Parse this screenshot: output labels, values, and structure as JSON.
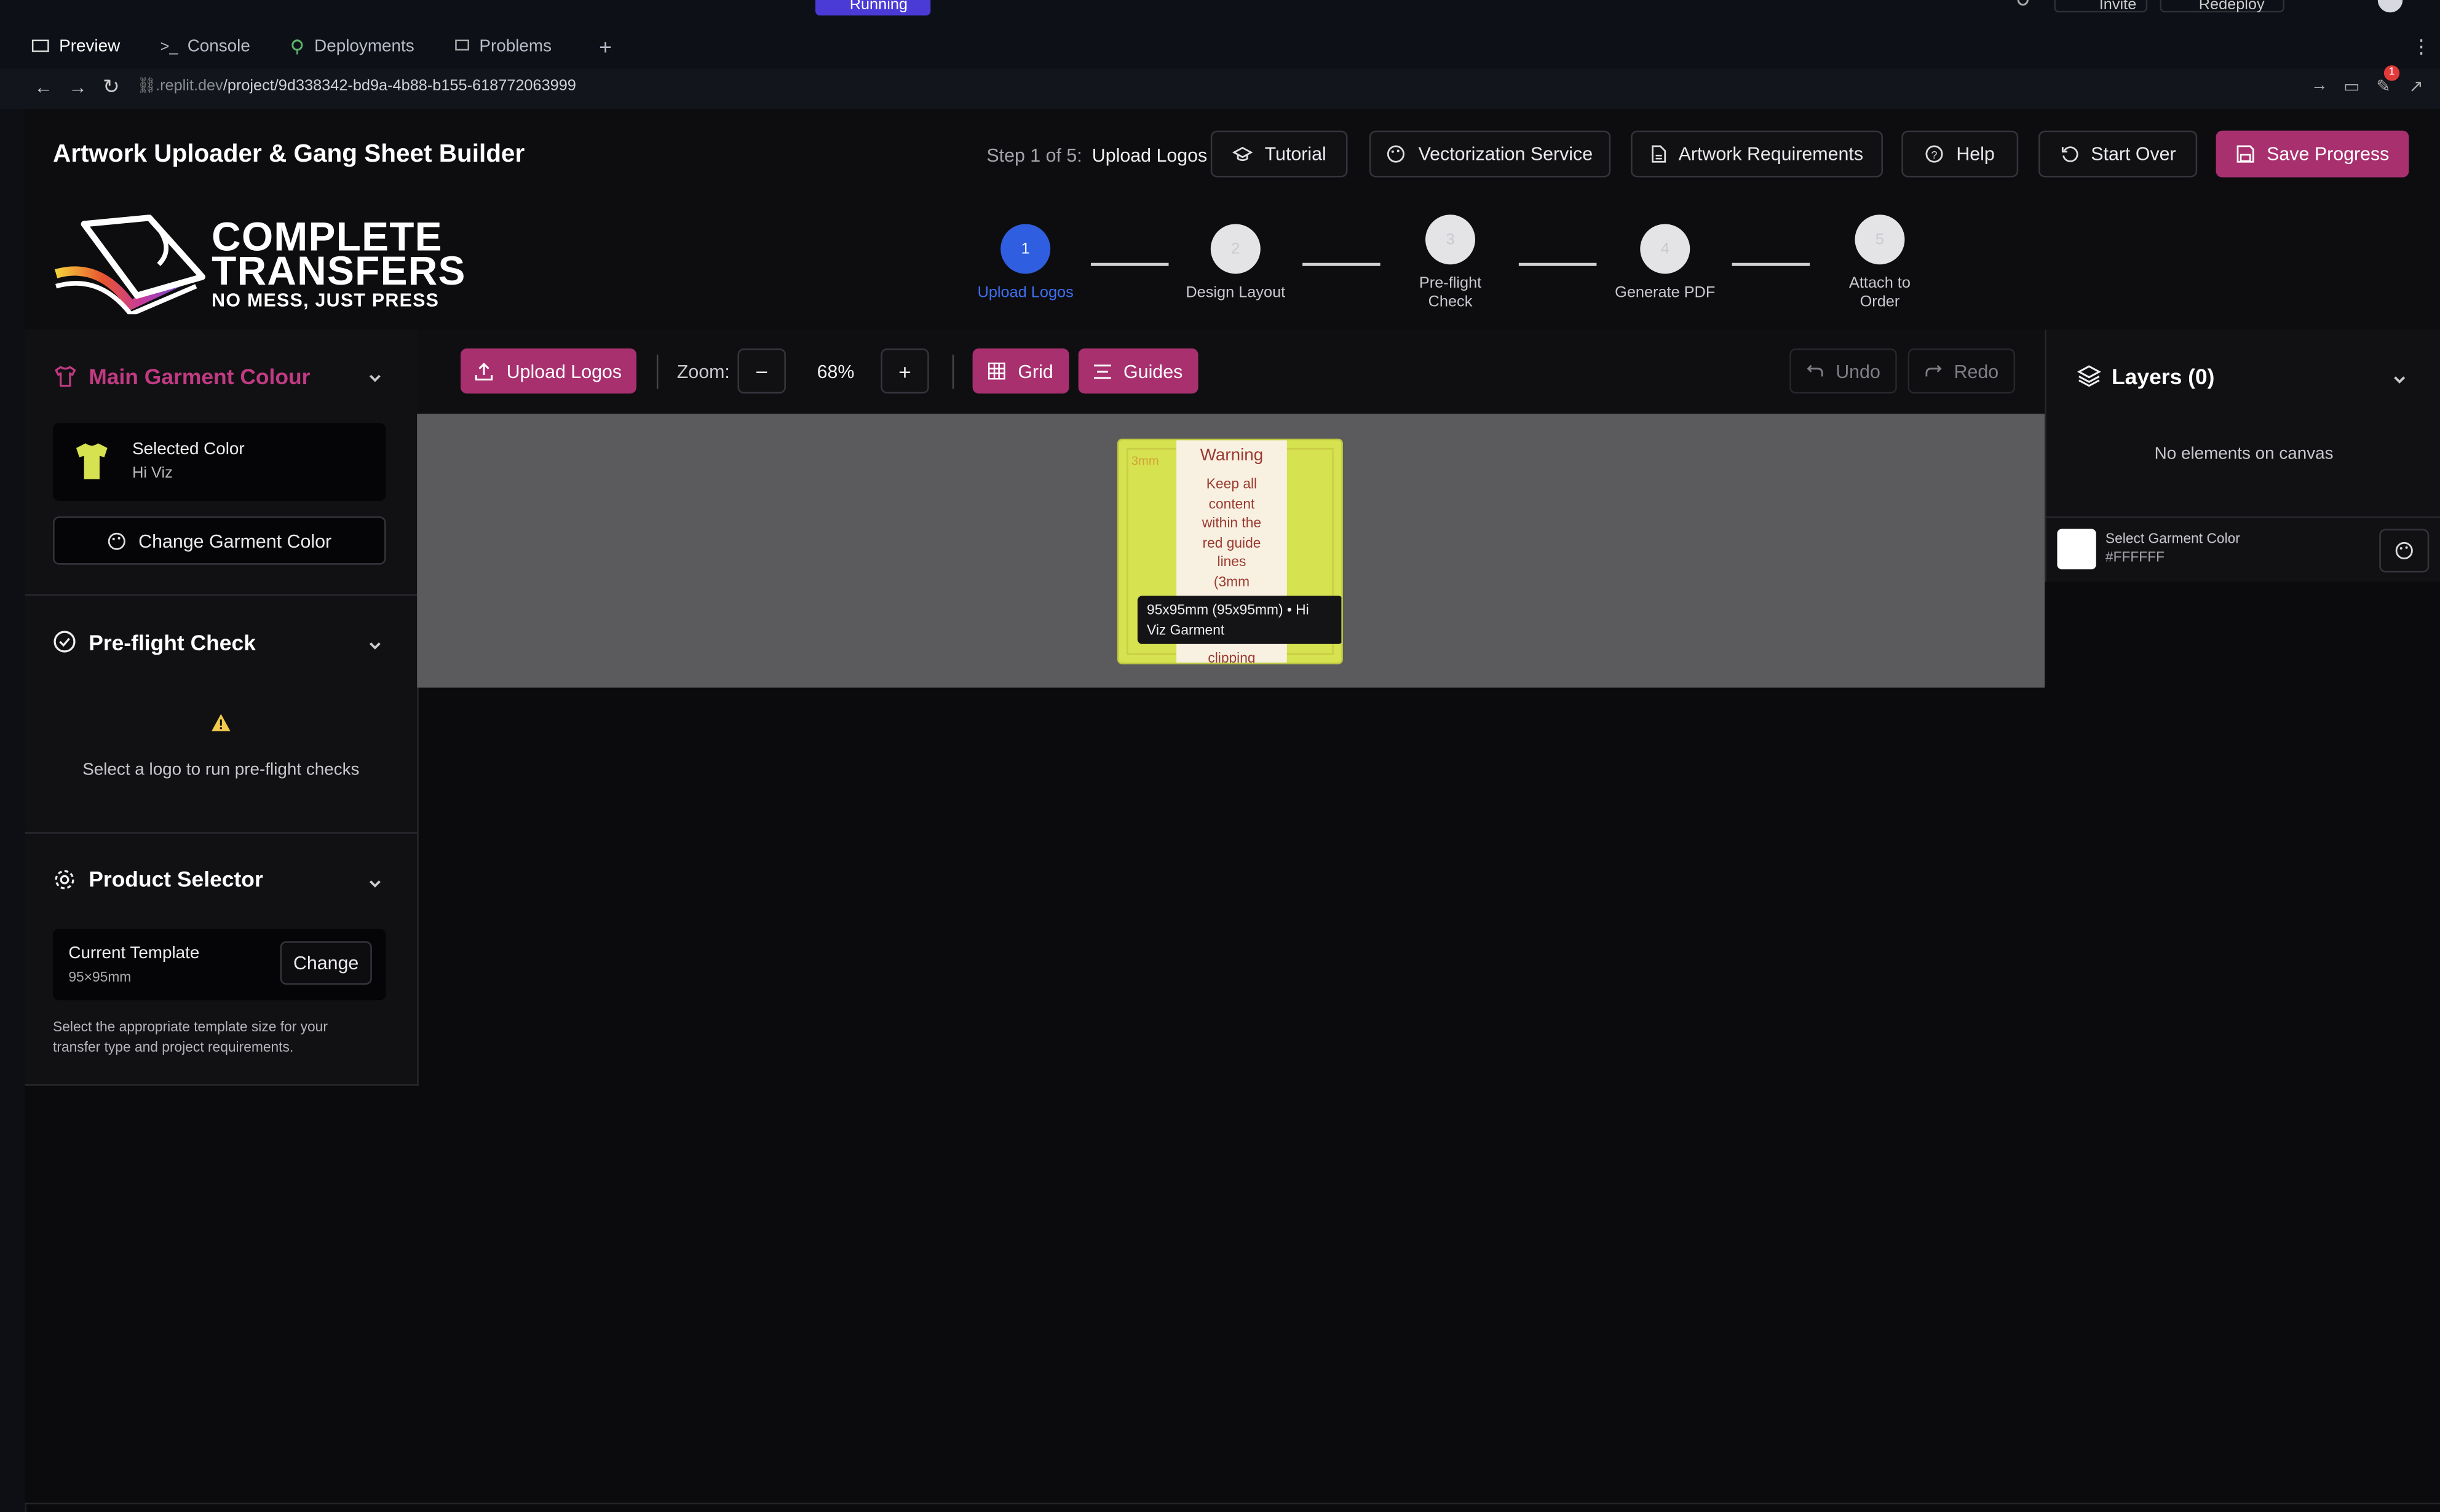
{
  "replit": {
    "run_status": "Running",
    "invite_label": "Invite",
    "redeploy_label": "Redeploy",
    "notification_count": "1",
    "tabs": [
      {
        "label": "Preview"
      },
      {
        "label": "Console"
      },
      {
        "label": "Deployments"
      },
      {
        "label": "Problems"
      }
    ],
    "url_domain": ".replit.dev",
    "url_path": "/project/9d338342-bd9a-4b88-b155-618772063999"
  },
  "header": {
    "title": "Artwork Uploader & Gang Sheet Builder",
    "step_indicator": "Step 1 of 5:",
    "step_name": "Upload Logos",
    "buttons": {
      "tutorial": "Tutorial",
      "vectorization": "Vectorization Service",
      "requirements": "Artwork Requirements",
      "help": "Help",
      "start_over": "Start Over",
      "save": "Save Progress"
    }
  },
  "logo": {
    "line1": "COMPLETE",
    "line2": "TRANSFERS",
    "tagline": "NO MESS, JUST PRESS"
  },
  "steps": [
    {
      "number": "1",
      "label": "Upload Logos",
      "active": true
    },
    {
      "number": "2",
      "label": "Design Layout"
    },
    {
      "number": "3",
      "label": "Pre-flight Check"
    },
    {
      "number": "4",
      "label": "Generate PDF"
    },
    {
      "number": "5",
      "label": "Attach to Order"
    }
  ],
  "left": {
    "garment": {
      "title": "Main Garment Colour",
      "selected_label": "Selected Color",
      "selected_value": "Hi Viz",
      "change_button": "Change Garment Color"
    },
    "preflight": {
      "title": "Pre-flight Check",
      "message": "Select a logo to run pre-flight checks"
    },
    "product": {
      "title": "Product Selector",
      "template_label": "Current Template",
      "template_value": "95×95mm",
      "change_button": "Change",
      "help_text": "Select the appropriate template size for your transfer type and project requirements."
    }
  },
  "toolbar": {
    "upload": "Upload Logos",
    "zoom_label": "Zoom:",
    "zoom_value": "68%",
    "grid": "Grid",
    "guides": "Guides",
    "undo": "Undo",
    "redo": "Redo"
  },
  "canvas": {
    "margin_label": "3mm",
    "warning_title": "Warning",
    "warning_lines": [
      "Keep all",
      "content",
      "within the",
      "red guide",
      "lines",
      "(3mm"
    ],
    "warning_tail": "clipping",
    "tooltip_line1": "95x95mm (95x95mm) • Hi",
    "tooltip_line2": "Viz Garment"
  },
  "right": {
    "layers_title": "Layers (0)",
    "empty_message": "No elements on canvas",
    "garment_label": "Select Garment Color",
    "garment_hex": "#FFFFFF"
  },
  "colors": {
    "accent_pink": "#a8306f",
    "step_active": "#2f5fe0",
    "hi_viz": "#d6e24f",
    "garment_white": "#FFFFFF"
  }
}
